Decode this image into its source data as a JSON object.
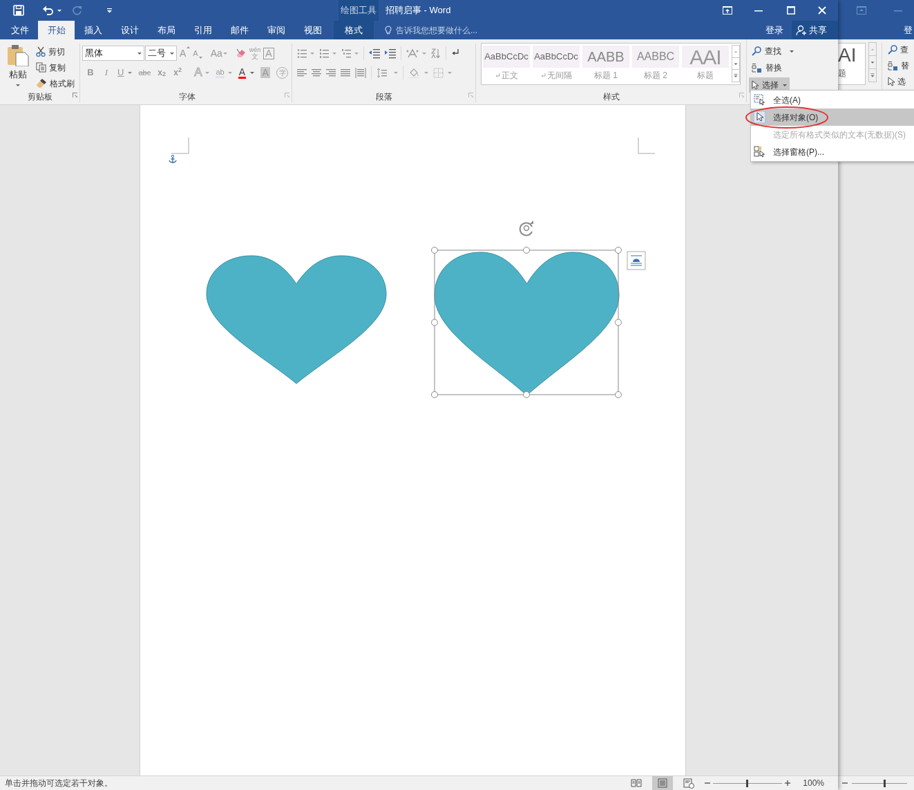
{
  "window": {
    "title": "招聘启事 - Word",
    "tool_group": "绘图工具"
  },
  "tabs": [
    {
      "label": "文件",
      "selected": false,
      "kind": "main"
    },
    {
      "label": "开始",
      "selected": true,
      "kind": "main"
    },
    {
      "label": "插入",
      "selected": false,
      "kind": "main"
    },
    {
      "label": "设计",
      "selected": false,
      "kind": "main"
    },
    {
      "label": "布局",
      "selected": false,
      "kind": "main"
    },
    {
      "label": "引用",
      "selected": false,
      "kind": "main"
    },
    {
      "label": "邮件",
      "selected": false,
      "kind": "main"
    },
    {
      "label": "审阅",
      "selected": false,
      "kind": "main"
    },
    {
      "label": "视图",
      "selected": false,
      "kind": "main"
    },
    {
      "label": "格式",
      "selected": false,
      "kind": "contextual"
    }
  ],
  "tell_me": {
    "placeholder": "告诉我您想要做什么..."
  },
  "account": {
    "sign_in": "登录",
    "share": "共享"
  },
  "clipboard": {
    "label": "剪贴板",
    "paste": "粘贴",
    "commands": [
      {
        "kind": "cut",
        "label": "剪切"
      },
      {
        "kind": "copy",
        "label": "复制"
      },
      {
        "kind": "painter",
        "label": "格式刷"
      }
    ]
  },
  "font": {
    "label": "字体",
    "name": "黑体",
    "size": "二号",
    "row_1": [
      {
        "kind": "grow",
        "label": "A"
      },
      {
        "kind": "shrink",
        "label": "A"
      },
      {
        "kind": "case",
        "label": "Aa"
      },
      {
        "kind": "clear"
      },
      {
        "kind": "phonetic",
        "label": "wén",
        "sub": "文"
      },
      {
        "kind": "border",
        "label": "A"
      }
    ],
    "row_2": [
      {
        "kind": "bold",
        "label": "B"
      },
      {
        "kind": "italic",
        "label": "I"
      },
      {
        "kind": "underline",
        "label": "U"
      },
      {
        "kind": "strike",
        "label": "abc"
      },
      {
        "kind": "subscript",
        "label": "x$_{2}$"
      },
      {
        "kind": "superscript",
        "label": "x$^{2}$"
      },
      {
        "kind": "effects",
        "label": "A"
      },
      {
        "kind": "highlight",
        "label": "ab"
      },
      {
        "kind": "color",
        "label": "A"
      },
      {
        "kind": "shading",
        "label": "A"
      },
      {
        "kind": "enclose",
        "label": "字"
      }
    ]
  },
  "paragraph": {
    "label": "段落"
  },
  "styles": {
    "label": "样式",
    "items": [
      {
        "preview": "AaBbCcDc",
        "name": "正文",
        "kind": "body",
        "paragraph_mark": true
      },
      {
        "preview": "AaBbCcDc",
        "name": "无间隔",
        "kind": "body",
        "paragraph_mark": true
      },
      {
        "preview": "AABB",
        "name": "标题 1",
        "kind": "heading1",
        "paragraph_mark": false
      },
      {
        "preview": "AABBC",
        "name": "标题 2",
        "kind": "heading2",
        "paragraph_mark": false
      },
      {
        "preview": "AAI",
        "name": "标题",
        "kind": "title",
        "paragraph_mark": false
      }
    ]
  },
  "editing": {
    "items": [
      {
        "kind": "find",
        "label": "查找",
        "expanded": false
      },
      {
        "kind": "replace",
        "label": "替换",
        "expanded": false
      },
      {
        "kind": "select",
        "label": "选择",
        "expanded": true
      }
    ]
  },
  "select_menu": [
    {
      "kind": "select_all",
      "label": "全选(A)",
      "selected": false,
      "disabled": false
    },
    {
      "kind": "select_objects",
      "label": "选择对象(O)",
      "selected": true,
      "disabled": false
    },
    {
      "kind": "similar",
      "label": "选定所有格式类似的文本(无数据)(S)",
      "selected": false,
      "disabled": true
    },
    {
      "kind": "pane",
      "label": "选择窗格(P)...",
      "selected": false,
      "disabled": false
    }
  ],
  "document": {
    "shapes": [
      {
        "kind": "heart",
        "selected": false
      },
      {
        "kind": "heart",
        "selected": true
      }
    ]
  },
  "status_bar": {
    "message": "单击并拖动可选定若干对象。",
    "views": [
      {
        "kind": "read",
        "selected": false
      },
      {
        "kind": "print",
        "selected": true
      },
      {
        "kind": "web",
        "selected": false
      }
    ],
    "zoom": {
      "level": 0.48,
      "reading": "100%"
    }
  },
  "background_window": {
    "zoom": {
      "level": 0.57
    },
    "sign_in": "登",
    "style_preview": "AI",
    "style_name": "题",
    "editing": [
      {
        "kind": "find",
        "label": "查"
      },
      {
        "kind": "replace",
        "label": "替"
      },
      {
        "kind": "select",
        "label": "选"
      }
    ]
  }
}
